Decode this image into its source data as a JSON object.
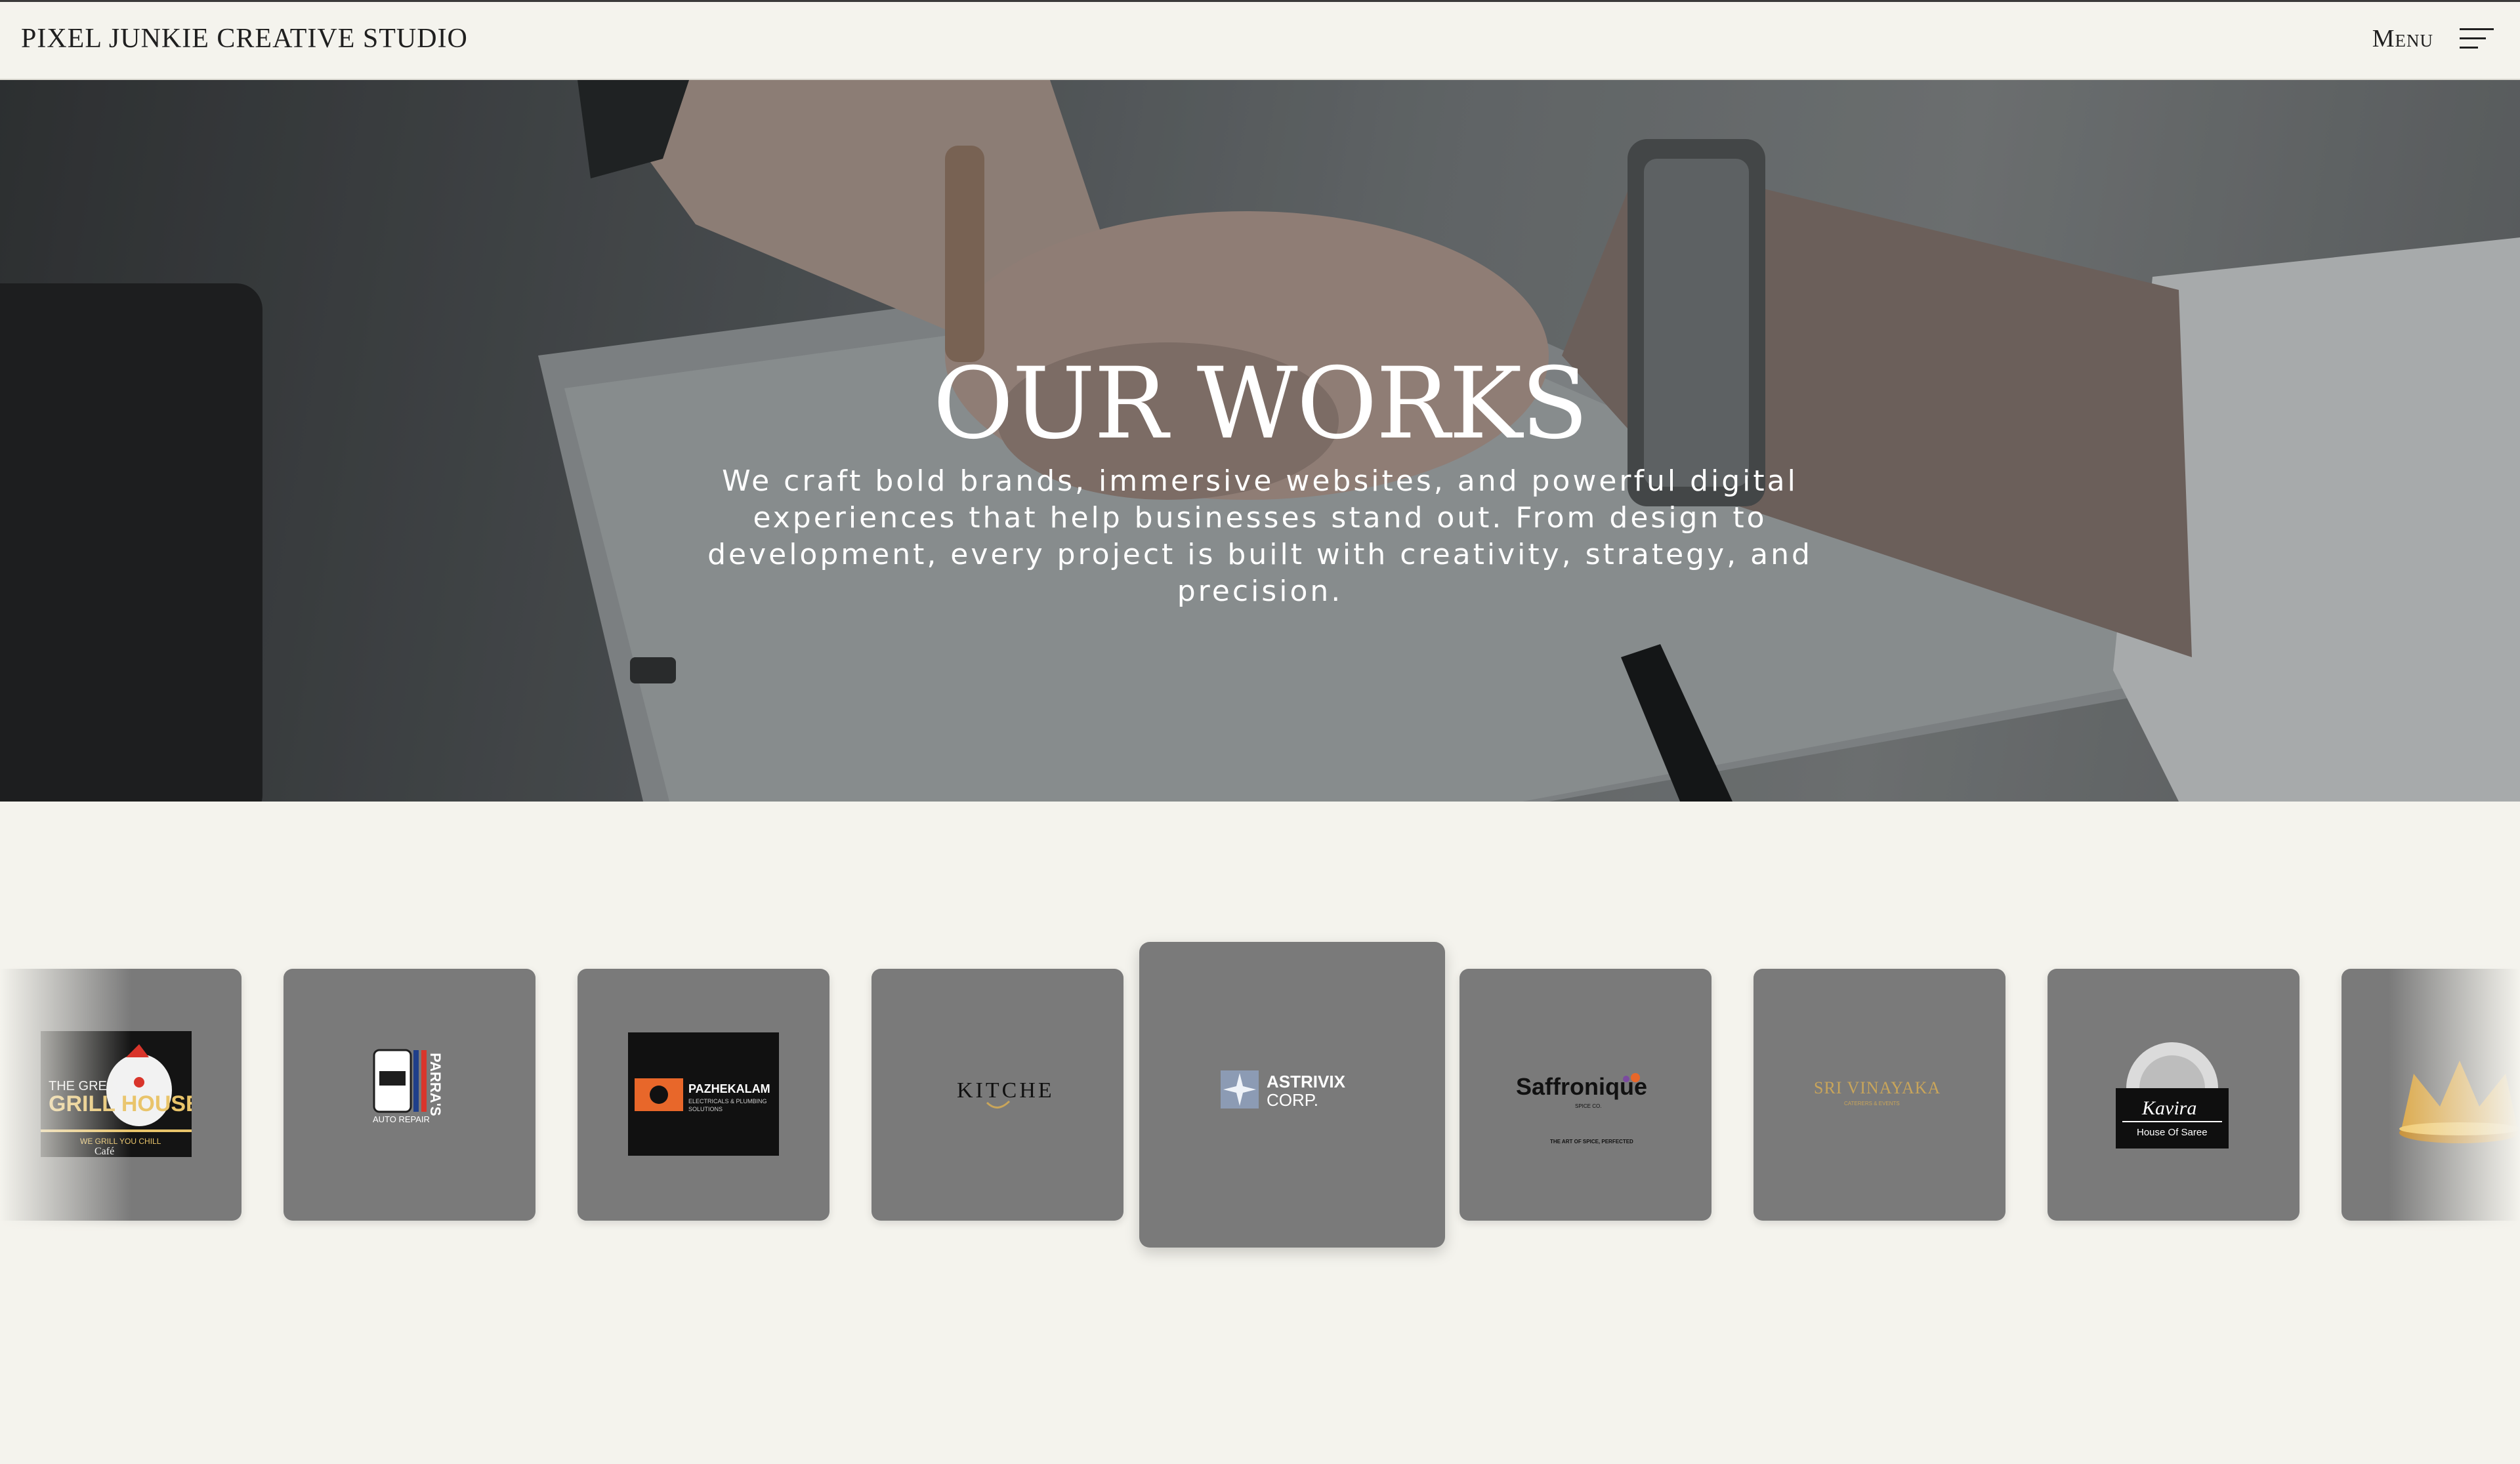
{
  "header": {
    "brand": "PIXEL JUNKIE CREATIVE STUDIO",
    "menu_label": "Menu",
    "menu_icon": "hamburger-menu-icon"
  },
  "hero": {
    "title": "OUR WORKS",
    "description": "We craft bold brands, immersive websites, and powerful digital experiences that help businesses stand out. From design to development, every project is built with creativity, strategy, and precision."
  },
  "works": [
    {
      "id": "grill-house",
      "lines": [
        "THE GREAT",
        "GRILL HOUSE",
        "WE GRILL YOU CHILL",
        "Café"
      ]
    },
    {
      "id": "parras",
      "lines": [
        "PARRA'S",
        "AUTO REPAIR"
      ]
    },
    {
      "id": "pazhekalam",
      "lines": [
        "PAZHEKALAM",
        "ELECTRICALS & PLUMBING",
        "SOLUTIONS"
      ]
    },
    {
      "id": "kitchen",
      "lines": [
        "KITCHEN"
      ]
    },
    {
      "id": "astrivix",
      "lines": [
        "ASTRIVIX",
        "CORP."
      ]
    },
    {
      "id": "saffronique",
      "lines": [
        "Saffronique",
        "SPICE CO.",
        "THE ART OF SPICE, PERFECTED"
      ]
    },
    {
      "id": "sri-vinayaka",
      "lines": [
        "SRI VINAYAKA",
        "CATERERS & EVENTS"
      ]
    },
    {
      "id": "kavira",
      "lines": [
        "Kavira",
        "House Of Saree"
      ]
    },
    {
      "id": "crown",
      "lines": []
    }
  ],
  "colors": {
    "page_bg": "#f4f3ed",
    "card_bg": "#7a7a7a",
    "text_dark": "#1f1f1f",
    "accent_orange": "#e8672a",
    "accent_gold": "#c9a55a"
  }
}
